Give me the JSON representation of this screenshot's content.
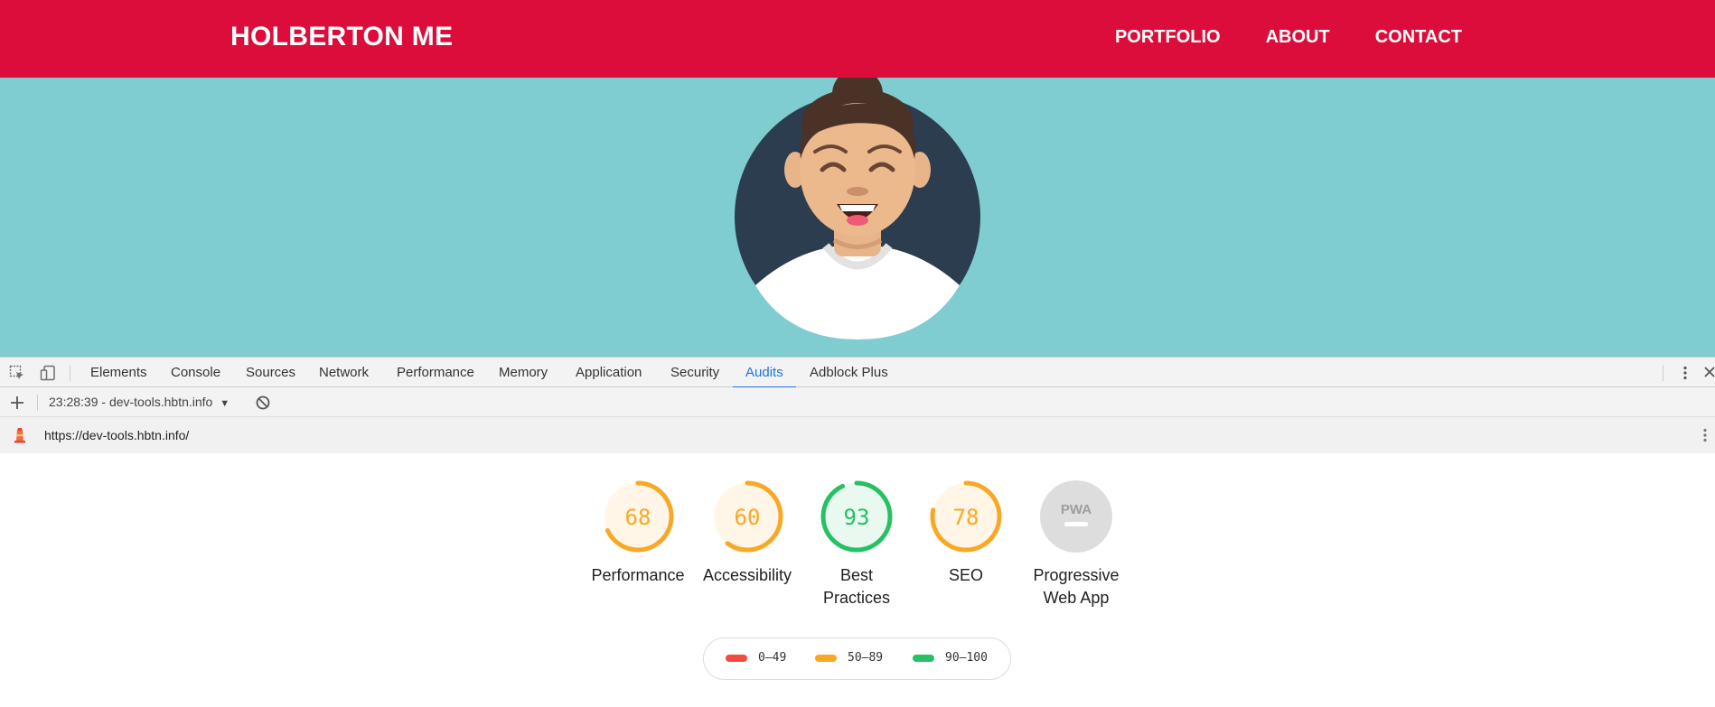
{
  "site": {
    "title": "HOLBERTON ME",
    "nav": [
      "PORTFOLIO",
      "ABOUT",
      "CONTACT"
    ],
    "colors": {
      "header": "#dc0d3a",
      "hero": "#7fcdd1"
    }
  },
  "devtools": {
    "tabs": [
      "Elements",
      "Console",
      "Sources",
      "Network",
      "Performance",
      "Memory",
      "Application",
      "Security",
      "Audits",
      "Adblock Plus"
    ],
    "active_tab": "Audits",
    "report_selector": "23:28:39 - dev-tools.hbtn.info",
    "audited_url": "https://dev-tools.hbtn.info/"
  },
  "audit": {
    "categories": [
      {
        "label": "Performance",
        "score": "68",
        "fraction": 0.68,
        "status": "average"
      },
      {
        "label": "Accessibility",
        "score": "60",
        "fraction": 0.6,
        "status": "average"
      },
      {
        "label": "Best Practices",
        "score": "93",
        "fraction": 0.93,
        "status": "pass"
      },
      {
        "label": "SEO",
        "score": "78",
        "fraction": 0.78,
        "status": "average"
      },
      {
        "label": "Progressive Web App",
        "score": "PWA",
        "fraction": 0,
        "status": "na"
      }
    ],
    "legend": [
      {
        "range": "0–49",
        "color": "#f34a3f"
      },
      {
        "range": "50–89",
        "color": "#f9a825"
      },
      {
        "range": "90–100",
        "color": "#25c164"
      }
    ],
    "colors": {
      "average": "#f9a825",
      "average_bg": "#fff6e8",
      "pass": "#25c164",
      "pass_bg": "#e9f9ef",
      "na": "#dddddd"
    }
  }
}
